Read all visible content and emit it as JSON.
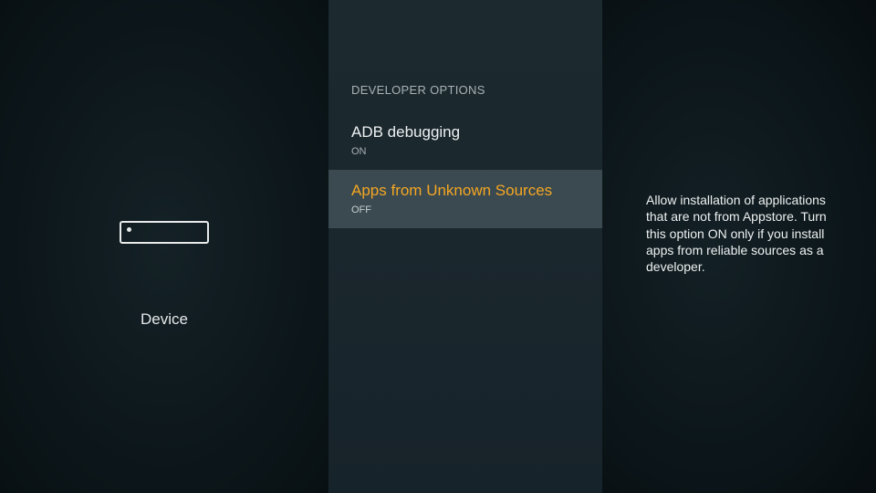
{
  "left_panel": {
    "icon": "device-icon",
    "label": "Device"
  },
  "middle_panel": {
    "section_title": "DEVELOPER OPTIONS",
    "items": [
      {
        "label": "ADB debugging",
        "value": "ON",
        "selected": false
      },
      {
        "label": "Apps from Unknown Sources",
        "value": "OFF",
        "selected": true
      }
    ]
  },
  "right_panel": {
    "description": "Allow installation of applications that are not from Appstore. Turn this option ON only if you install apps from reliable sources as a developer."
  },
  "colors": {
    "accent": "#f5a623",
    "selected_bg": "#3a4a50"
  }
}
